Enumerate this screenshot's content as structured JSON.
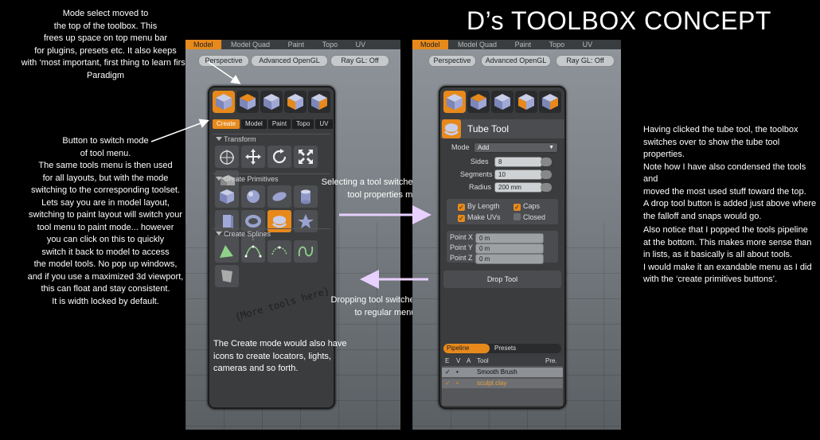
{
  "title": "D’s TOOLBOX CONCEPT",
  "notes": {
    "mode_moved": "Mode select moved to\nthe top of the toolbox.  This\nfrees up space on top menu bar\nfor plugins, presets etc.  It also keeps\nwith ‘most important, first thing to learn first’\nParadigm",
    "switch_mode": "Button to switch mode\nof tool menu.\nThe same tools menu is then used\nfor all layouts, but with the mode\nswitching to the corresponding toolset.\nLets say you are in model layout,\nswitching to paint layout will switch your\ntool menu to paint mode... however\nyou can click on this to quickly\nswitch it back to model to access\nthe model tools.  No pop up windows,\nand if you use a maximized 3d viewport,\nthis can float and stay consistent.\nIt is width locked by default.",
    "create_mode": "The Create mode would also have\nicons to create locators, lights,\ncameras and so forth.",
    "selecting_tool": "Selecting a tool switches palette to\ntool properties mode.",
    "dropping_tool": "Dropping tool switches back\nto regular menu",
    "tube_clicked": "Having clicked the tube tool, the toolbox\nswitches over to show the tube tool properties.\nNote how I have also condensed the tools and\nmoved the most used stuff toward the top.\nA drop tool button is added just above where\nthe falloff and snaps would go.",
    "pipeline": "Also notice that I popped the tools pipeline\nat the bottom.  This makes more sense than\nin lists, as it basically is all about tools.\nI would make it an exandable menu as I did\nwith the ‘create primitives buttons’."
  },
  "viewport_left": {
    "top_tabs": [
      "Model",
      "Model Quad",
      "Paint",
      "Topo",
      "UV"
    ],
    "view_buttons": [
      "Perspective",
      "Advanced OpenGL",
      "Ray GL: Off"
    ]
  },
  "viewport_right": {
    "top_tabs": [
      "Model",
      "Model Quad",
      "Paint",
      "Topo",
      "UV"
    ],
    "view_buttons": [
      "Perspective",
      "Advanced OpenGL",
      "Ray GL: Off"
    ]
  },
  "toolbox": {
    "mode_tabs": [
      "Create",
      "Model",
      "Paint",
      "Topo",
      "UV"
    ],
    "sections": {
      "transform": "Transform",
      "primitives": "Create Primitives",
      "splines": "Create Splines"
    },
    "more_tools": "{More tools here}"
  },
  "tube_tool": {
    "title": "Tube Tool",
    "mode_label": "Mode",
    "mode_value": "Add",
    "sides_label": "Sides",
    "sides_value": "8",
    "segments_label": "Segments",
    "segments_value": "10",
    "radius_label": "Radius",
    "radius_value": "200 mm",
    "by_length": "By Length",
    "caps": "Caps",
    "make_uvs": "Make UVs",
    "closed": "Closed",
    "point_x_label": "Point X",
    "point_x_value": "0 m",
    "point_y_label": "Point Y",
    "point_y_value": "0 m",
    "point_z_label": "Point Z",
    "point_z_value": "0 m",
    "drop_tool": "Drop Tool"
  },
  "pipeline": {
    "tabs": [
      "Pipeline",
      "Presets"
    ],
    "headers": [
      "E",
      "V",
      "A",
      "Tool",
      "Pre."
    ],
    "rows": [
      {
        "e": "✓",
        "v": "•",
        "tool": "Smooth Brush"
      },
      {
        "e": "✓",
        "v": "•",
        "tool": "sculpt.clay"
      }
    ]
  },
  "colors": {
    "accent": "#e7891b",
    "panel": "#3b3c3e"
  }
}
